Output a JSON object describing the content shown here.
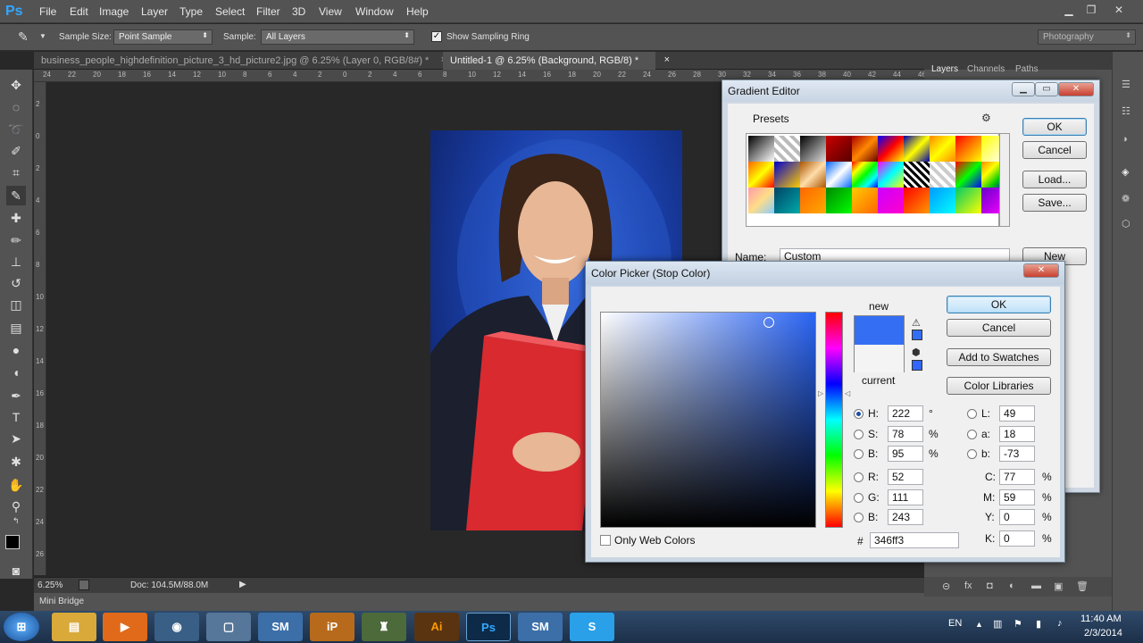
{
  "app": {
    "logo": "Ps"
  },
  "menu": [
    "File",
    "Edit",
    "Image",
    "Layer",
    "Type",
    "Select",
    "Filter",
    "3D",
    "View",
    "Window",
    "Help"
  ],
  "options_bar": {
    "sample_size_label": "Sample Size:",
    "sample_size_value": "Point Sample",
    "sample_label": "Sample:",
    "sample_value": "All Layers",
    "show_ring_label": "Show Sampling Ring",
    "workspace": "Photography"
  },
  "doc_tabs": [
    {
      "label": "business_people_highdefinition_picture_3_hd_picture2.jpg @ 6.25% (Layer 0, RGB/8#) *"
    },
    {
      "label": "Untitled-1 @ 6.25% (Background, RGB/8) *"
    }
  ],
  "ruler_h": [
    "24",
    "22",
    "20",
    "18",
    "16",
    "14",
    "12",
    "10",
    "8",
    "6",
    "4",
    "2",
    "0",
    "2",
    "4",
    "6",
    "8",
    "10",
    "12",
    "14",
    "16",
    "18",
    "20",
    "22",
    "24",
    "26",
    "28",
    "30",
    "32",
    "34",
    "36",
    "38",
    "40",
    "42",
    "44",
    "46",
    "48"
  ],
  "ruler_v": [
    "2",
    "0",
    "2",
    "4",
    "6",
    "8",
    "10",
    "12",
    "14",
    "16",
    "18",
    "20",
    "22",
    "24",
    "26"
  ],
  "panel_tabs": [
    "Layers",
    "Channels",
    "Paths"
  ],
  "status": {
    "zoom": "6.25%",
    "doc": "Doc: 104.5M/88.0M"
  },
  "minibridge": "Mini Bridge",
  "gradient_editor": {
    "title": "Gradient Editor",
    "presets_label": "Presets",
    "ok": "OK",
    "cancel": "Cancel",
    "load": "Load...",
    "save": "Save...",
    "name_label": "Name:",
    "name_value": "Custom",
    "new": "New"
  },
  "color_picker": {
    "title": "Color Picker (Stop Color)",
    "new_label": "new",
    "current_label": "current",
    "ok": "OK",
    "cancel": "Cancel",
    "add_swatches": "Add to Swatches",
    "color_libraries": "Color Libraries",
    "H": {
      "label": "H:",
      "value": "222",
      "unit": "°"
    },
    "S": {
      "label": "S:",
      "value": "78",
      "unit": "%"
    },
    "Bv": {
      "label": "B:",
      "value": "95",
      "unit": "%"
    },
    "R": {
      "label": "R:",
      "value": "52"
    },
    "G": {
      "label": "G:",
      "value": "111"
    },
    "Bc": {
      "label": "B:",
      "value": "243"
    },
    "L": {
      "label": "L:",
      "value": "49"
    },
    "a": {
      "label": "a:",
      "value": "18"
    },
    "b": {
      "label": "b:",
      "value": "-73"
    },
    "C": {
      "label": "C:",
      "value": "77",
      "unit": "%"
    },
    "M": {
      "label": "M:",
      "value": "59",
      "unit": "%"
    },
    "Y": {
      "label": "Y:",
      "value": "0",
      "unit": "%"
    },
    "K": {
      "label": "K:",
      "value": "0",
      "unit": "%"
    },
    "hex_label": "#",
    "hex": "346ff3",
    "web_only": "Only Web Colors",
    "new_color": "#346ff3",
    "current_color": "#f4f4f4"
  },
  "taskbar": {
    "lang": "EN",
    "time": "11:40 AM",
    "date": "2/3/2014",
    "apps": [
      "Start",
      "Explorer",
      "Media",
      "Chrome",
      "Files",
      "SM",
      "InPage",
      "Game",
      "Ai",
      "Ps",
      "SM",
      "Skype"
    ]
  }
}
